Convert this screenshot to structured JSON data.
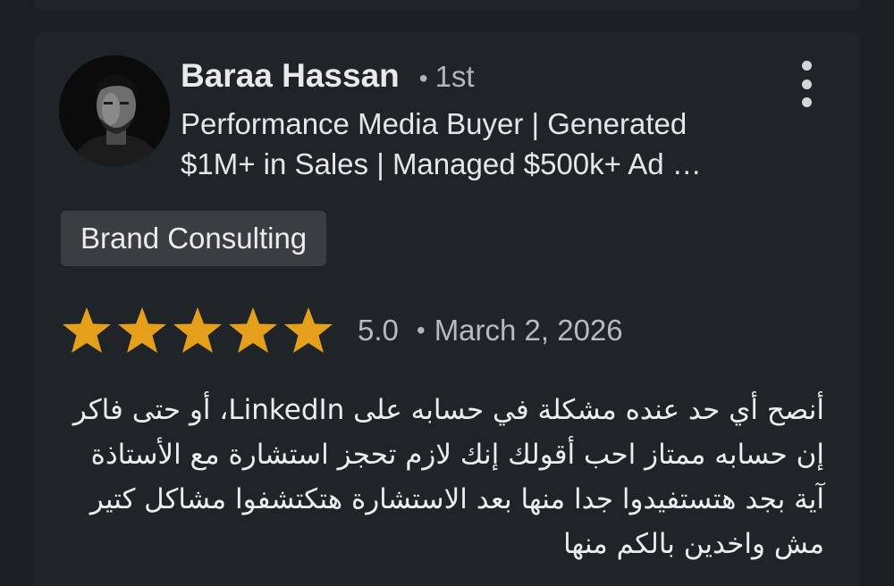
{
  "reviewer": {
    "name": "Baraa Hassan",
    "degree": "1st",
    "headline": "Performance Media Buyer | Generated $1M+ in Sales | Managed $500k+ Ad …",
    "avatar_icon": "profile-photo"
  },
  "service_tag": "Brand Consulting",
  "rating": {
    "value": 5,
    "max": 5,
    "score_label": "5.0",
    "date": "March 2, 2026",
    "star_color": "#e59f1a"
  },
  "separator": "•",
  "review_text": "أنصح أي حد عنده مشكلة في حسابه على LinkedIn، أو حتى فاكر إن حسابه ممتاز احب أقولك إنك لازم تحجز استشارة مع الأستاذة آية بجد هتستفيدوا جدا منها بعد الاستشارة هتكتشفوا مشاكل كتير مش واخدين بالكم منها",
  "more_menu_icon": "more-vertical-icon"
}
